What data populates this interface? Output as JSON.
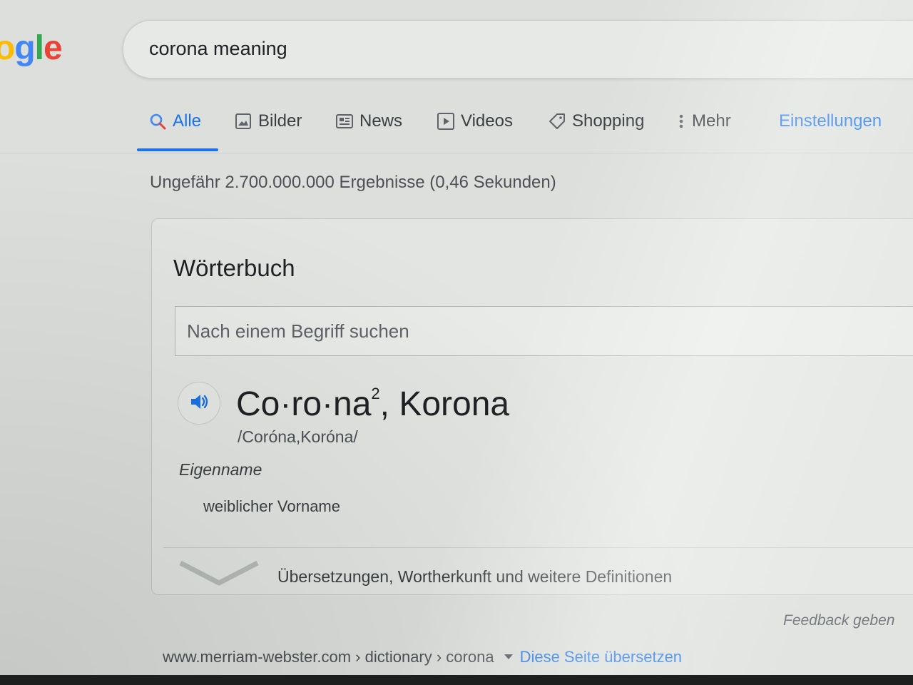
{
  "logo": {
    "text_parts": [
      "o",
      "g",
      "l",
      "e"
    ]
  },
  "search": {
    "query": "corona meaning"
  },
  "tabs": [
    {
      "label": "Alle",
      "icon": "search-icon"
    },
    {
      "label": "Bilder",
      "icon": "image-icon"
    },
    {
      "label": "News",
      "icon": "news-icon"
    },
    {
      "label": "Videos",
      "icon": "play-icon"
    },
    {
      "label": "Shopping",
      "icon": "tag-icon"
    },
    {
      "label": "Mehr",
      "icon": "more-vertical-icon"
    }
  ],
  "settings_label": "Einstellungen",
  "result_stats": "Ungefähr 2.700.000.000 Ergebnisse (0,46 Sekunden)",
  "dictionary": {
    "title": "Wörterbuch",
    "search_placeholder": "Nach einem Begriff suchen",
    "headword": "Co·ro·na",
    "homograph_number": "2",
    "variant": ", Korona",
    "phonetic": "/Coróna,Koróna/",
    "part_of_speech": "Eigenname",
    "definition": "weiblicher Vorname",
    "expand_label": "Übersetzungen, Wortherkunft und weitere Definitionen"
  },
  "feedback_label": "Feedback geben",
  "next_result": {
    "breadcrumb": "www.merriam-webster.com › dictionary › corona",
    "translate_label": "Diese Seite übersetzen"
  },
  "colors": {
    "accent_blue": "#1a73e8",
    "google_blue": "#4285f4",
    "google_yellow": "#fbbc05",
    "google_green": "#34a853",
    "google_red": "#ea4335"
  }
}
